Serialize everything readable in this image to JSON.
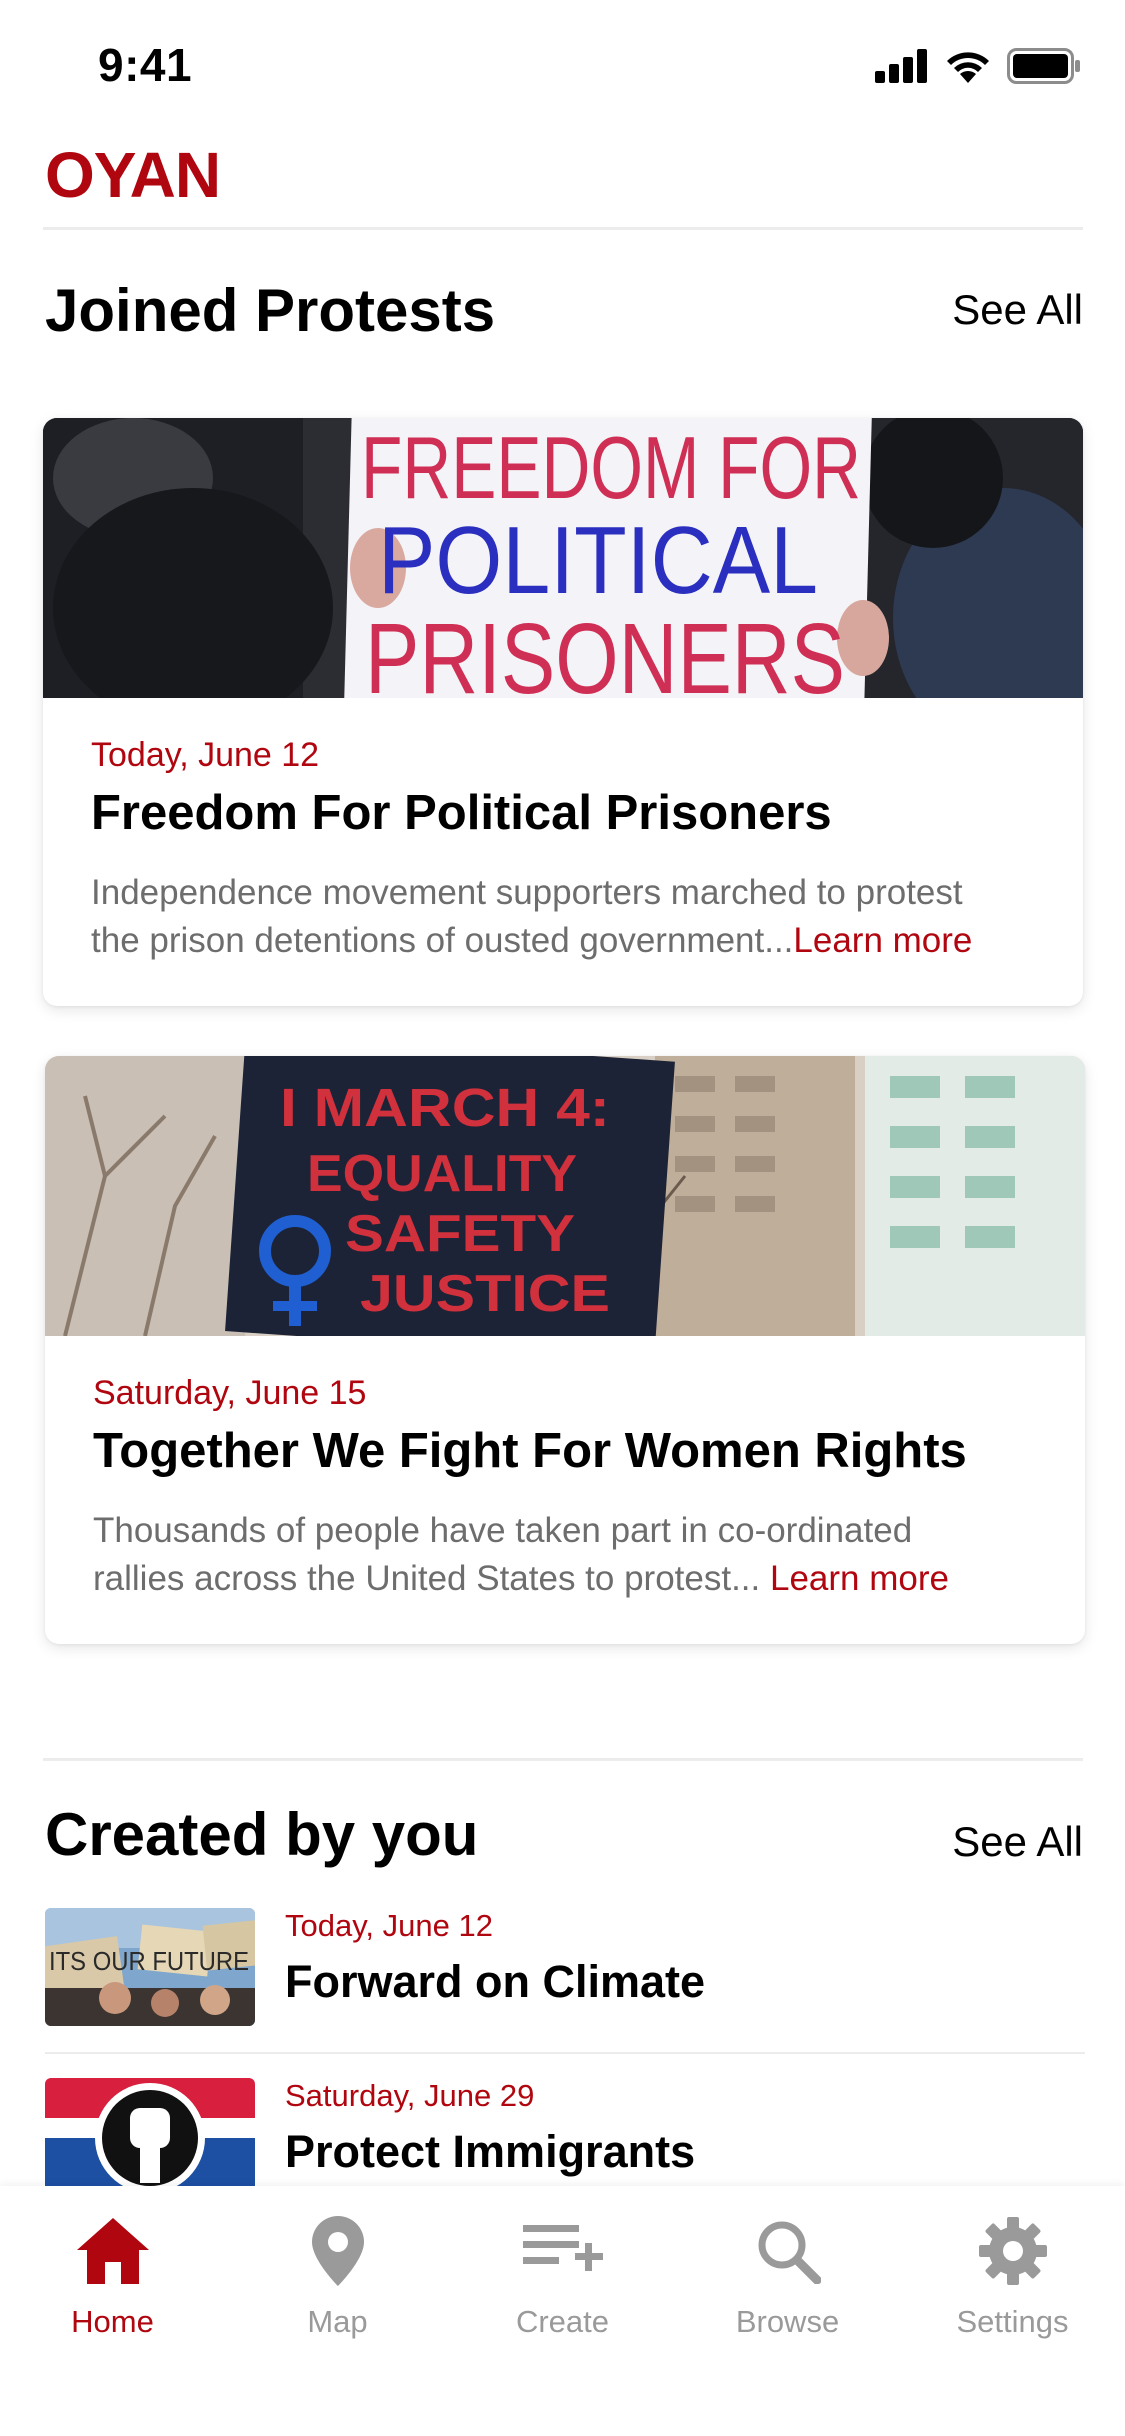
{
  "status_bar": {
    "time": "9:41"
  },
  "app": {
    "logo": "OYAN",
    "brand_color": "#b0060f"
  },
  "joined": {
    "title": "Joined Protests",
    "see_all": "See All",
    "cards": [
      {
        "date": "Today, June 12",
        "title": "Freedom For Political Prisoners",
        "desc_line1": "Independence movement supporters marched to protest",
        "desc_line2": "the prison detentions of ousted government...",
        "learn_more": "Learn more",
        "sign_lines": [
          "FREEDOM FOR",
          "POLITICAL",
          "PRISONERS"
        ]
      },
      {
        "date": "Saturday, June 15",
        "title": "Together We Fight For Women Rights",
        "desc_line1": "Thousands of people have taken part in co-ordinated",
        "desc_line2": "rallies across the United States to protest... ",
        "learn_more": "Learn more",
        "sign_lines": [
          "I MARCH 4:",
          "EQUALITY",
          "SAFETY",
          "JUSTICE"
        ]
      }
    ]
  },
  "created": {
    "title": "Created by you",
    "see_all": "See All",
    "items": [
      {
        "date": "Today, June 12",
        "title": "Forward on Climate",
        "sign_text": "ITS OUR FUTURE"
      },
      {
        "date": "Saturday, June 29",
        "title": "Protect Immigrants"
      }
    ]
  },
  "tabs": [
    {
      "label": "Home",
      "icon": "home-icon",
      "active": true
    },
    {
      "label": "Map",
      "icon": "map-pin-icon",
      "active": false
    },
    {
      "label": "Create",
      "icon": "create-list-icon",
      "active": false
    },
    {
      "label": "Browse",
      "icon": "search-icon",
      "active": false
    },
    {
      "label": "Settings",
      "icon": "gear-icon",
      "active": false
    }
  ]
}
